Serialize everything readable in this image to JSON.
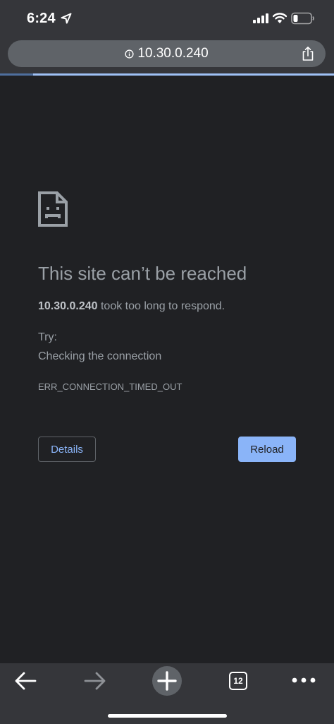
{
  "status_bar": {
    "time": "6:24",
    "icons": [
      "location-arrow-icon",
      "cellular-signal-icon",
      "wifi-icon",
      "battery-low-icon"
    ]
  },
  "address_bar": {
    "url": "10.30.0.240",
    "leading_icon": "info-icon",
    "trailing_icon": "share-icon"
  },
  "page_load_progress": 0.1,
  "error_page": {
    "icon": "sad-file-icon",
    "title": "This site can’t be reached",
    "host": "10.30.0.240",
    "message": " took too long to respond.",
    "try_label": "Try:",
    "suggestions": [
      "Checking the connection"
    ],
    "error_code": "ERR_CONNECTION_TIMED_OUT",
    "details_label": "Details",
    "reload_label": "Reload"
  },
  "toolbar": {
    "tab_count": "12",
    "icons": [
      "back-arrow-icon",
      "forward-arrow-icon",
      "new-tab-plus-icon",
      "tab-switcher-icon",
      "more-menu-icon"
    ]
  },
  "colors": {
    "page_background": "#202124",
    "chrome_background": "#35363a",
    "accent": "#8ab4f8",
    "muted_text": "#9aa0a6"
  }
}
